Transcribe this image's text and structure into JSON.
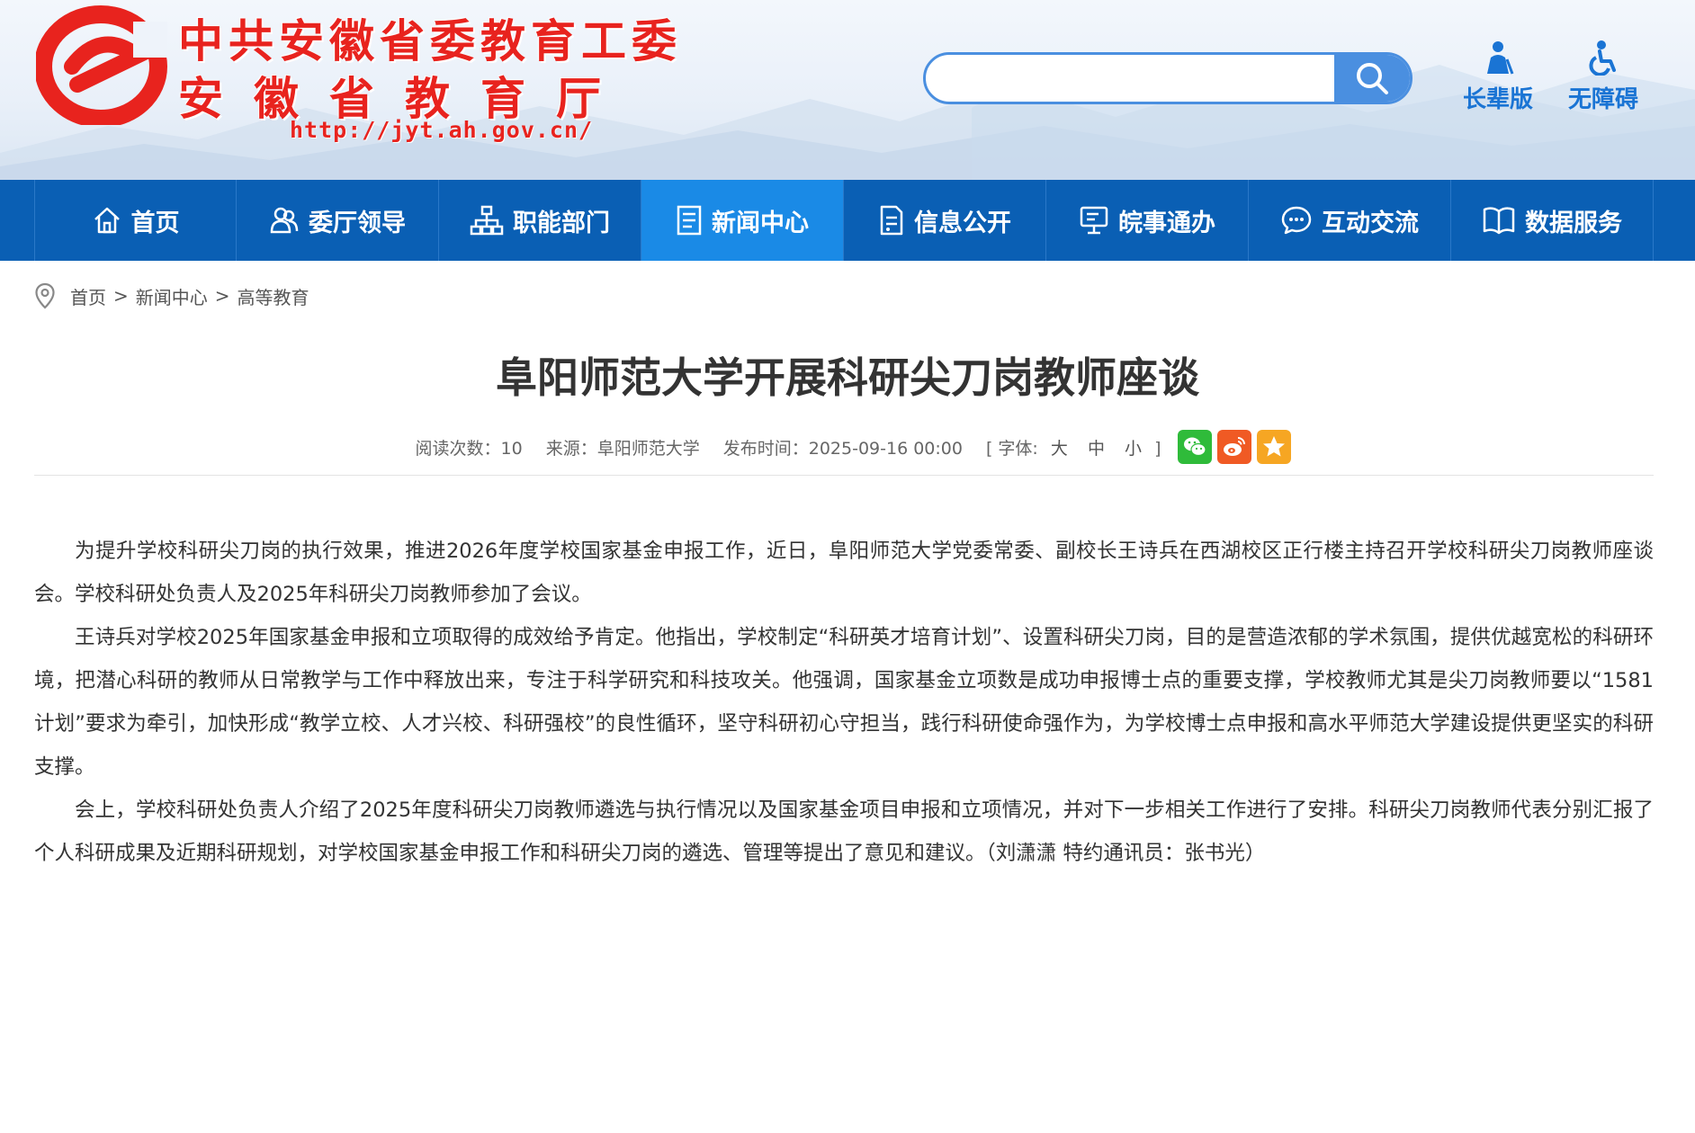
{
  "header": {
    "site_name_line1": "中共安徽省委教育工委",
    "site_name_line2": "安徽省教育厅",
    "site_url": "http://jyt.ah.gov.cn/",
    "search": {
      "placeholder": "",
      "value": "",
      "icon": "search-icon"
    },
    "tools": [
      {
        "label": "长辈版",
        "icon": "elder-person-icon"
      },
      {
        "label": "无障碍",
        "icon": "wheelchair-icon"
      }
    ],
    "colors": {
      "brand_red": "#e8231e",
      "accent_blue": "#1a74d4",
      "search_blue": "#4a8fe0"
    }
  },
  "nav": {
    "items": [
      {
        "label": "首页",
        "icon": "home-icon"
      },
      {
        "label": "委厅领导",
        "icon": "leaders-icon"
      },
      {
        "label": "职能部门",
        "icon": "org-chart-icon"
      },
      {
        "label": "新闻中心",
        "icon": "news-icon",
        "active": true
      },
      {
        "label": "信息公开",
        "icon": "document-icon"
      },
      {
        "label": "皖事通办",
        "icon": "monitor-icon"
      },
      {
        "label": "互动交流",
        "icon": "chat-icon"
      },
      {
        "label": "数据服务",
        "icon": "book-icon"
      }
    ],
    "colors": {
      "bar": "#0a5fb4",
      "active": "#1a8ae6"
    }
  },
  "breadcrumb": {
    "icon": "location-pin-icon",
    "items": [
      "首页",
      "新闻中心",
      "高等教育"
    ],
    "separator": ">"
  },
  "article": {
    "title": "阜阳师范大学开展科研尖刀岗教师座谈",
    "meta": {
      "views_label": "阅读次数：",
      "views": "10",
      "source_label": "来源：",
      "source": "阜阳师范大学",
      "published_label": "发布时间：",
      "published": "2025-09-16 00:00",
      "font_open": "[ 字体:",
      "font_large": "大",
      "font_medium": "中",
      "font_small": "小",
      "font_close": "]",
      "share_icons": [
        "wechat-icon",
        "weibo-icon",
        "favorite-star-icon"
      ]
    },
    "paragraphs": [
      "为提升学校科研尖刀岗的执行效果，推进2026年度学校国家基金申报工作，近日，阜阳师范大学党委常委、副校长王诗兵在西湖校区正行楼主持召开学校科研尖刀岗教师座谈会。学校科研处负责人及2025年科研尖刀岗教师参加了会议。",
      "王诗兵对学校2025年国家基金申报和立项取得的成效给予肯定。他指出，学校制定“科研英才培育计划”、设置科研尖刀岗，目的是营造浓郁的学术氛围，提供优越宽松的科研环境，把潜心科研的教师从日常教学与工作中释放出来，专注于科学研究和科技攻关。他强调，国家基金立项数是成功申报博士点的重要支撑，学校教师尤其是尖刀岗教师要以“1581计划”要求为牵引，加快形成“教学立校、人才兴校、科研强校”的良性循环，坚守科研初心守担当，践行科研使命强作为，为学校博士点申报和高水平师范大学建设提供更坚实的科研支撑。",
      "会上，学校科研处负责人介绍了2025年度科研尖刀岗教师遴选与执行情况以及国家基金项目申报和立项情况，并对下一步相关工作进行了安排。科研尖刀岗教师代表分别汇报了个人科研成果及近期科研规划，对学校国家基金申报工作和科研尖刀岗的遴选、管理等提出了意见和建议。（刘潇潇 特约通讯员：张书光）"
    ]
  }
}
